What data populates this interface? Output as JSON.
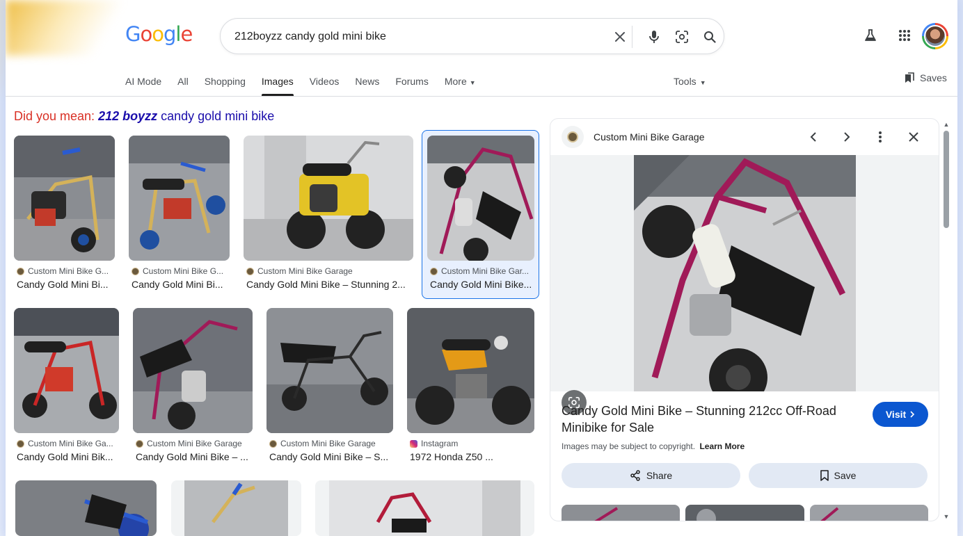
{
  "header": {
    "logo": [
      "G",
      "o",
      "o",
      "g",
      "l",
      "e"
    ],
    "search_query": "212boyzz candy gold mini bike",
    "icons": [
      "clear-icon",
      "mic-icon",
      "lens-icon",
      "search-icon",
      "labs-icon",
      "apps-icon",
      "avatar"
    ]
  },
  "tabs": [
    {
      "label": "AI Mode"
    },
    {
      "label": "All"
    },
    {
      "label": "Shopping"
    },
    {
      "label": "Images",
      "active": true
    },
    {
      "label": "Videos"
    },
    {
      "label": "News"
    },
    {
      "label": "Forums"
    },
    {
      "label": "More"
    }
  ],
  "tools_label": "Tools",
  "saves_label": "Saves",
  "did_you_mean": {
    "label": "Did you mean:",
    "bold": "212 boyzz",
    "rest": " candy gold mini bike"
  },
  "results": [
    {
      "source": "Custom Mini Bike G...",
      "title": "Candy Gold Mini Bi..."
    },
    {
      "source": "Custom Mini Bike G...",
      "title": "Candy Gold Mini Bi..."
    },
    {
      "source": "Custom Mini Bike Garage",
      "title": "Candy Gold Mini Bike – Stunning 2..."
    },
    {
      "source": "Custom Mini Bike Gar...",
      "title": "Candy Gold Mini Bike..."
    },
    {
      "source": "Custom Mini Bike Ga...",
      "title": "Candy Gold Mini Bik..."
    },
    {
      "source": "Custom Mini Bike Garage",
      "title": "Candy Gold Mini Bike – ..."
    },
    {
      "source": "Custom Mini Bike Garage",
      "title": "Candy Gold Mini Bike – S..."
    },
    {
      "source": "Instagram",
      "title": "1972 Honda Z50 ..."
    }
  ],
  "panel": {
    "source": "Custom Mini Bike Garage",
    "title": "Candy Gold Mini Bike – Stunning 212cc Off-Road Minibike for Sale",
    "visit_label": "Visit",
    "copyright": "Images may be subject to copyright.",
    "learn_more": "Learn More",
    "share_label": "Share",
    "save_label": "Save"
  },
  "colors": {
    "accent": "#0b57d0",
    "link": "#1a0dab",
    "did_you_mean": "#d93025",
    "selected_border": "#1a73e8"
  }
}
